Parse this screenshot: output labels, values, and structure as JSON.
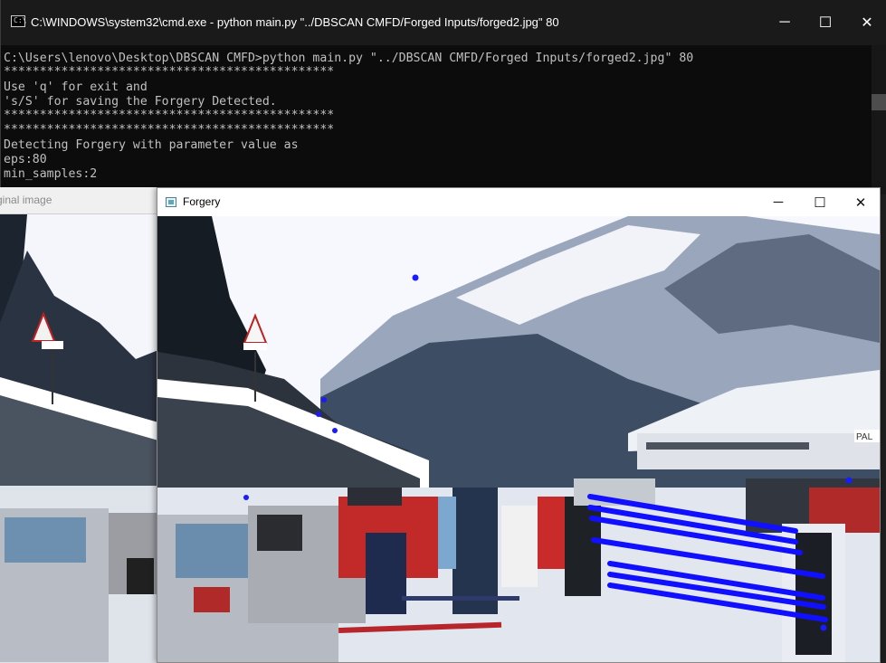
{
  "cmd": {
    "title": "C:\\WINDOWS\\system32\\cmd.exe - python  main.py \"../DBSCAN CMFD/Forged Inputs/forged2.jpg\" 80",
    "icon": "cmd-icon",
    "lines": [
      "C:\\Users\\lenovo\\Desktop\\DBSCAN CMFD>python main.py \"../DBSCAN CMFD/Forged Inputs/forged2.jpg\" 80",
      "**********************************************",
      "Use 'q' for exit and",
      "'s/S' for saving the Forgery Detected.",
      "**********************************************",
      "**********************************************",
      "Detecting Forgery with parameter value as",
      "eps:80",
      "min_samples:2"
    ]
  },
  "original_window": {
    "title": "ginal image"
  },
  "forgery_window": {
    "title": "Forgery"
  },
  "window_controls": {
    "minimize": "─",
    "maximize": "☐",
    "close": "✕"
  },
  "colors": {
    "cmd_bg": "#0c0c0c",
    "cmd_text": "#c0c0c0",
    "match_lines": "#1010ff",
    "keypoints": "#1a1aff"
  },
  "photo_sign": "PAL"
}
